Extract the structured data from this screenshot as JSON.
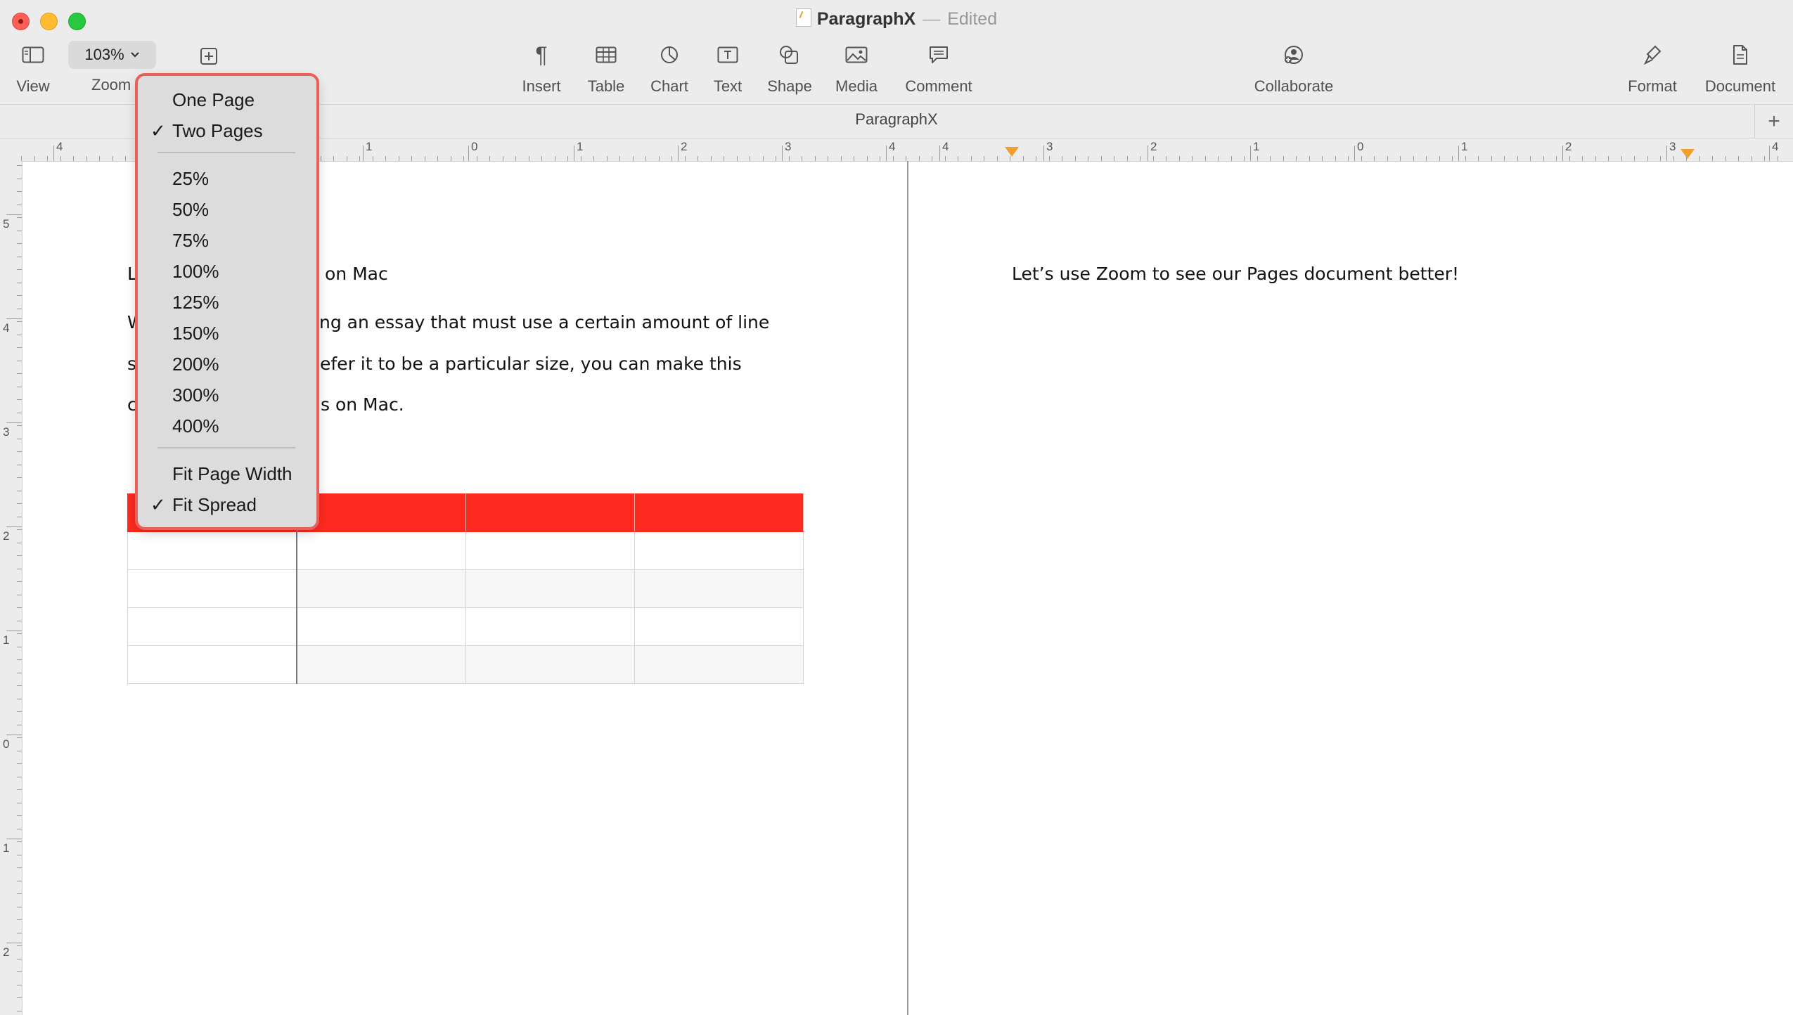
{
  "window": {
    "title": "ParagraphX",
    "title_separator": "—",
    "title_status": "Edited"
  },
  "toolbar": {
    "view_label": "View",
    "zoom_value": "103%",
    "zoom_label": "Zoom",
    "insert_label": "Insert",
    "table_label": "Table",
    "chart_label": "Chart",
    "text_label": "Text",
    "shape_label": "Shape",
    "media_label": "Media",
    "comment_label": "Comment",
    "collaborate_label": "Collaborate",
    "format_label": "Format",
    "document_label": "Document"
  },
  "tabbar": {
    "doc_title": "ParagraphX",
    "add_tab": "+"
  },
  "ruler": {
    "h_numbers": [
      "4",
      "1",
      "0",
      "1",
      "2",
      "3",
      "4",
      "4",
      "3",
      "2",
      "1",
      "0",
      "1",
      "2",
      "3",
      "4"
    ],
    "v_numbers": [
      "5",
      "4",
      "3",
      "2",
      "1",
      "0",
      "1",
      "2"
    ]
  },
  "zoom_menu": {
    "items": [
      {
        "label": "One Page",
        "checked": false
      },
      {
        "label": "Two Pages",
        "checked": true
      },
      {
        "label": "25%",
        "checked": false
      },
      {
        "label": "50%",
        "checked": false
      },
      {
        "label": "75%",
        "checked": false
      },
      {
        "label": "100%",
        "checked": false
      },
      {
        "label": "125%",
        "checked": false
      },
      {
        "label": "150%",
        "checked": false
      },
      {
        "label": "200%",
        "checked": false
      },
      {
        "label": "300%",
        "checked": false
      },
      {
        "label": "400%",
        "checked": false
      },
      {
        "label": "Fit Page Width",
        "checked": false
      },
      {
        "label": "Fit Spread",
        "checked": true
      }
    ],
    "check_glyph": "✓"
  },
  "left_page": {
    "heading_start": "L",
    "heading_end": "on Mac",
    "line1_start": "W",
    "line1_end": "ng an essay that must use a certain amount of line",
    "line2_start": "s",
    "line2_end": "efer it to be a particular size, you can make this",
    "line3_start": "c",
    "line3_end": "s on Mac."
  },
  "right_page": {
    "text": "Let’s use Zoom to see our Pages document better!"
  },
  "table": {
    "header_color": "#ff2a1f",
    "rows": 5,
    "cols": 4
  }
}
